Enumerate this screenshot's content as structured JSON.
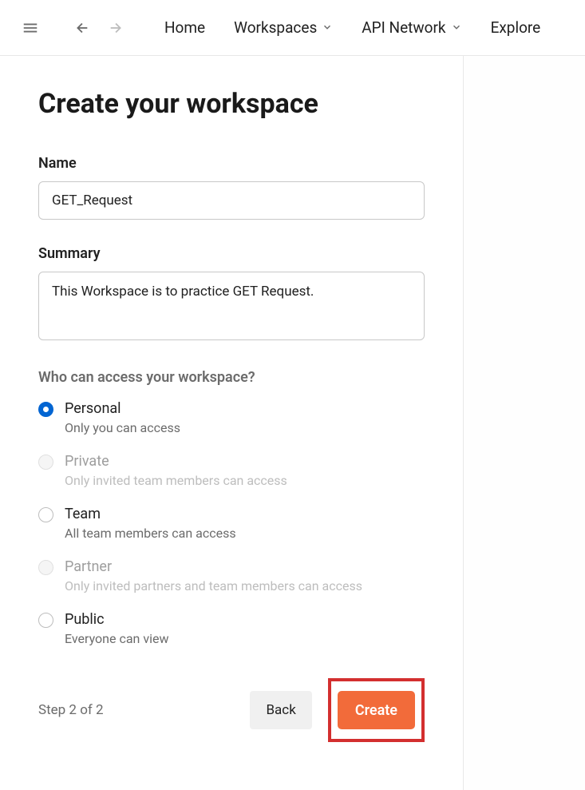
{
  "nav": {
    "home": "Home",
    "workspaces": "Workspaces",
    "api_network": "API Network",
    "explore": "Explore"
  },
  "page_title": "Create your workspace",
  "form": {
    "name_label": "Name",
    "name_value": "GET_Request",
    "summary_label": "Summary",
    "summary_value": "This Workspace is to practice GET Request.",
    "access_label": "Who can access your workspace?"
  },
  "access_options": {
    "personal": {
      "title": "Personal",
      "desc": "Only you can access",
      "selected": true
    },
    "private": {
      "title": "Private",
      "desc": "Only invited team members can access",
      "selected": false,
      "disabled": true
    },
    "team": {
      "title": "Team",
      "desc": "All team members can access",
      "selected": false
    },
    "partner": {
      "title": "Partner",
      "desc": "Only invited partners and team members can access",
      "selected": false,
      "disabled": true
    },
    "public": {
      "title": "Public",
      "desc": "Everyone can view",
      "selected": false
    }
  },
  "footer": {
    "step": "Step 2 of 2",
    "back": "Back",
    "create": "Create"
  }
}
